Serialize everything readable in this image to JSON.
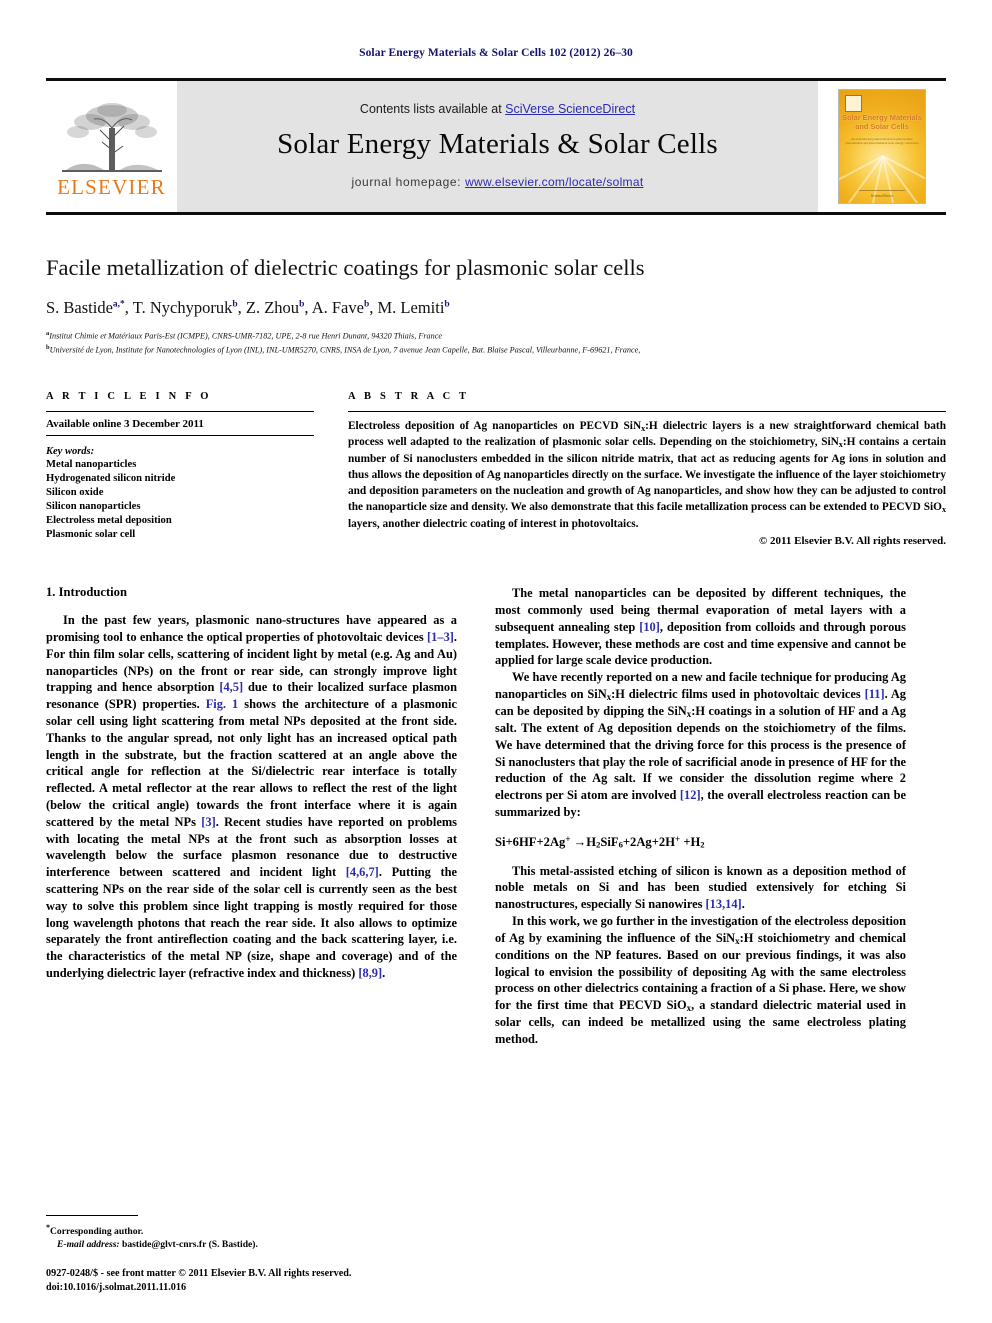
{
  "running_head": "Solar Energy Materials & Solar Cells 102 (2012) 26–30",
  "banner": {
    "contents_prefix": "Contents lists available at ",
    "contents_link": "SciVerse ScienceDirect",
    "journal_title": "Solar Energy Materials & Solar Cells",
    "homepage_prefix": "journal homepage: ",
    "homepage_url": "www.elsevier.com/locate/solmat",
    "publisher_wordmark": "ELSEVIER",
    "cover": {
      "title_line1": "Solar Energy Materials",
      "title_line2": "and Solar Cells",
      "subtitle": "An international journal devoted to photovoltaic, photothermal and photochemical solar energy conversion",
      "footer": "ScienceDirect"
    },
    "colors": {
      "link": "#2b2bae",
      "elsevier_orange": "#e8791b",
      "banner_grey": "#e3e3e3"
    }
  },
  "article": {
    "title": "Facile metallization of dielectric coatings for plasmonic solar cells",
    "authors": [
      {
        "name": "S. Bastide",
        "marks": "a,*"
      },
      {
        "name": "T. Nychyporuk",
        "marks": "b"
      },
      {
        "name": "Z. Zhou",
        "marks": "b"
      },
      {
        "name": "A. Fave",
        "marks": "b"
      },
      {
        "name": "M. Lemiti",
        "marks": "b"
      }
    ],
    "affiliations": [
      {
        "mark": "a",
        "text": "Institut Chimie et Matériaux Paris-Est (ICMPE), CNRS-UMR-7182, UPE, 2-8 rue Henri Dunant, 94320 Thiais, France"
      },
      {
        "mark": "b",
        "text": "Université de Lyon, Institute for Nanotechnologies of Lyon (INL), INL-UMR5270, CNRS, INSA de Lyon, 7 avenue Jean Capelle, Bat. Blaise Pascal, Villeurbanne, F-69621, France,"
      }
    ]
  },
  "article_info": {
    "heading": "A R T I C L E   I N F O",
    "available_online": "Available online 3 December 2011",
    "keywords_label": "Key words:",
    "keywords": [
      "Metal nanoparticles",
      "Hydrogenated silicon nitride",
      "Silicon oxide",
      "Silicon nanoparticles",
      "Electroless metal deposition",
      "Plasmonic solar cell"
    ]
  },
  "abstract": {
    "heading": "A B S T R A C T",
    "text": "Electroless deposition of Ag nanoparticles on PECVD SiNx:H dielectric layers is a new straightforward chemical bath process well adapted to the realization of plasmonic solar cells. Depending on the stoichiometry, SiNx:H contains a certain number of Si nanoclusters embedded in the silicon nitride matrix, that act as reducing agents for Ag ions in solution and thus allows the deposition of Ag nanoparticles directly on the surface. We investigate the influence of the layer stoichiometry and deposition parameters on the nucleation and growth of Ag nanoparticles, and show how they can be adjusted to control the nanoparticle size and density. We also demonstrate that this facile metallization process can be extended to PECVD SiOx layers, another dielectric coating of interest in photovoltaics.",
    "copyright": "© 2011 Elsevier B.V. All rights reserved."
  },
  "body": {
    "section1_title": "1.  Introduction",
    "left_paragraphs": [
      "In the past few years, plasmonic nano-structures have appeared as a promising tool to enhance the optical properties of photovoltaic devices [1–3]. For thin film solar cells, scattering of incident light by metal (e.g. Ag and Au) nanoparticles (NPs) on the front or rear side, can strongly improve light trapping and hence absorption [4,5] due to their localized surface plasmon resonance (SPR) properties. Fig. 1 shows the architecture of a plasmonic solar cell using light scattering from metal NPs deposited at the front side. Thanks to the angular spread, not only light has an increased optical path length in the substrate, but the fraction scattered at an angle above the critical angle for reflection at the Si/dielectric rear interface is totally reflected. A metal reflector at the rear allows to reflect the rest of the light (below the critical angle) towards the front interface where it is again scattered by the metal NPs [3]. Recent studies have reported on problems with locating the metal NPs at the front such as absorption losses at wavelength below the surface plasmon resonance due to destructive interference between scattered and incident light [4,6,7]. Putting the scattering NPs on the rear side of the solar cell is currently seen as the best way to solve this problem since light trapping is mostly required for those long wavelength photons that reach the rear side. It also allows to optimize separately the front antireflection coating and the back scattering layer, i.e. the characteristics of the metal NP (size, shape and coverage) and of the underlying dielectric layer (refractive index and thickness) [8,9]."
    ],
    "right_paragraphs": [
      "The metal nanoparticles can be deposited by different techniques, the most commonly used being thermal evaporation of metal layers with a subsequent annealing step [10], deposition from colloids and through porous templates. However, these methods are cost and time expensive and cannot be applied for large scale device production.",
      "We have recently reported on a new and facile technique for producing Ag nanoparticles on SiNx:H dielectric films used in photovoltaic devices [11]. Ag can be deposited by dipping the SiNx:H coatings in a solution of HF and a Ag salt. The extent of Ag deposition depends on the stoichiometry of the films. We have determined that the driving force for this process is the presence of Si nanoclusters that play the role of sacrificial anode in presence of HF for the reduction of the Ag salt. If we consider the dissolution regime where 2 electrons per Si atom are involved [12], the overall electroless reaction can be summarized by:",
      "This metal-assisted etching of silicon is known as a deposition method of noble metals on Si and has been studied extensively for etching Si nanostructures, especially Si nanowires [13,14].",
      "In this work, we go further in the investigation of the electroless deposition of Ag by examining the influence of the SiNx:H stoichiometry and chemical conditions on the NP features. Based on our previous findings, it was also logical to envision the possibility of depositing Ag with the same electroless process on other dielectrics containing a fraction of a Si phase. Here, we show for the first time that PECVD SiOx, a standard dielectric material used in solar cells, can indeed be metallized using the same electroless plating method."
    ],
    "equation": "Si+6HF+2Ag+ →H2SiF6+2Ag+2H+ +H2"
  },
  "footnote": {
    "corresponding": "Corresponding author.",
    "email_label": "E-mail address:",
    "email": "bastide@glvt-cnrs.fr (S. Bastide).",
    "issn_line1": "0927-0248/$ - see front matter © 2011 Elsevier B.V. All rights reserved.",
    "issn_line2": "doi:10.1016/j.solmat.2011.11.016"
  }
}
